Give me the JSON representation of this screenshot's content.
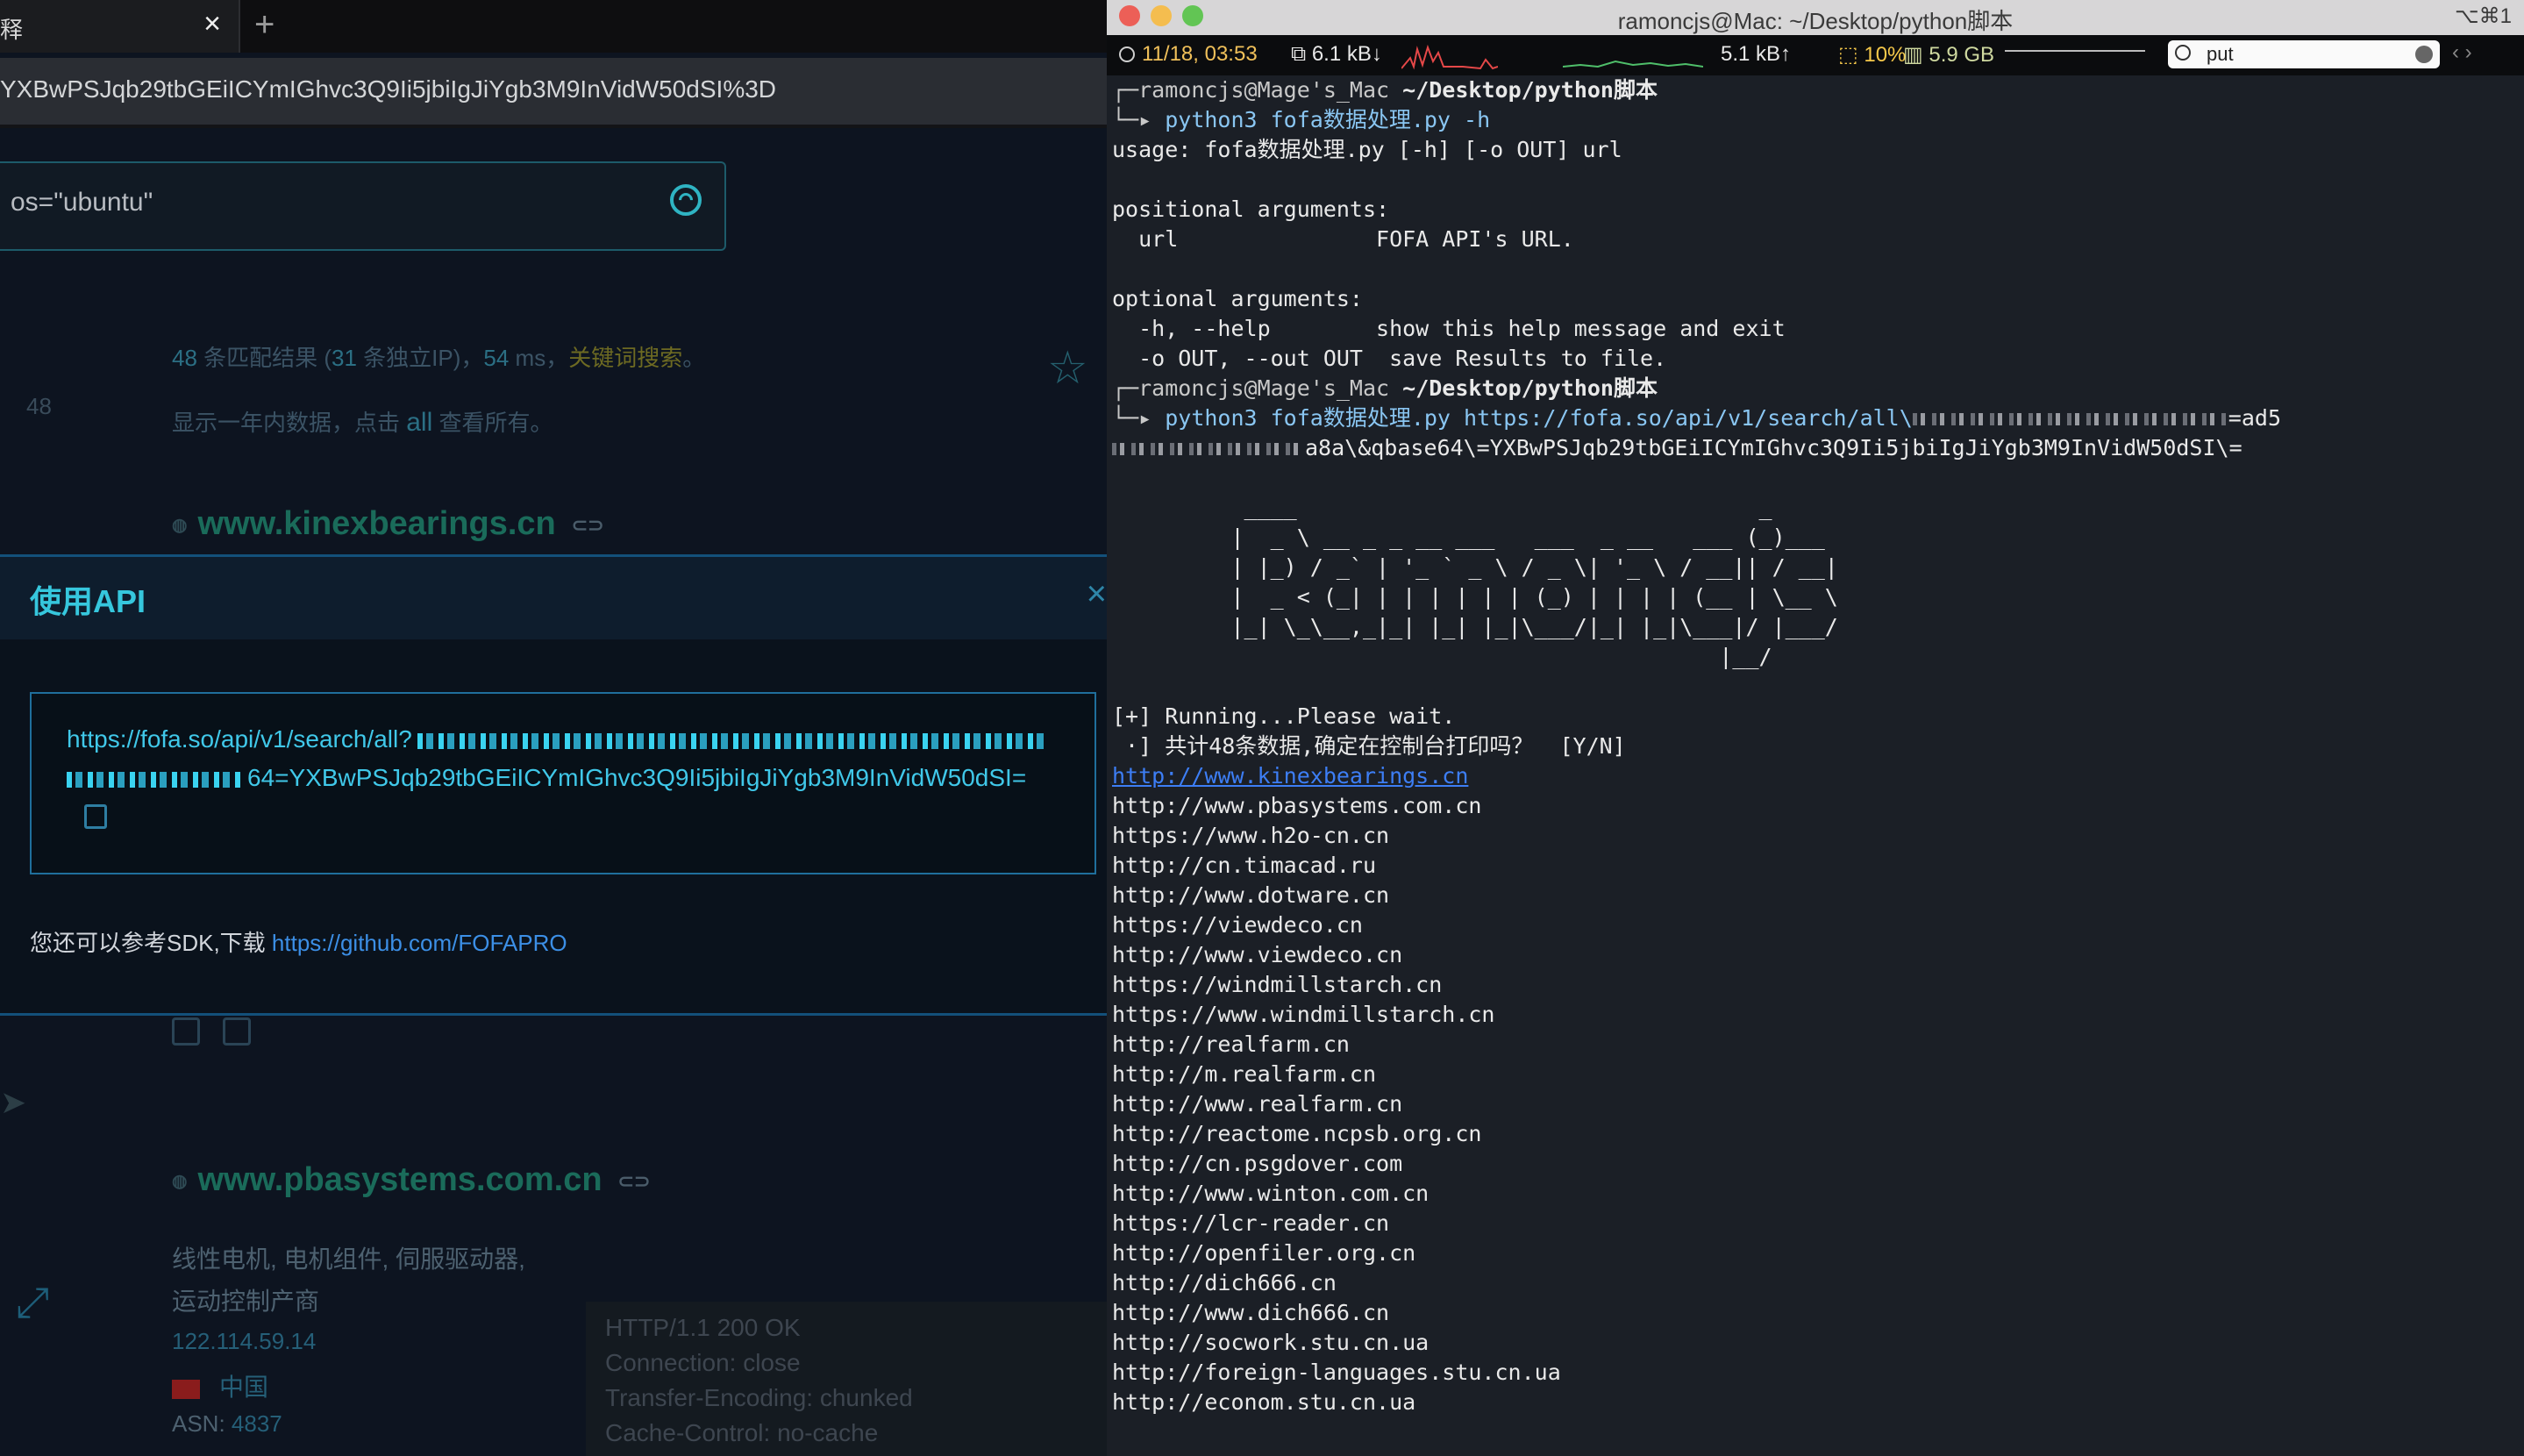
{
  "browser": {
    "tab_title": "释",
    "tab_close": "×",
    "new_tab": "+",
    "address": "YXBwPSJqb29tbGEiICYmIGhvc3Q9Ii5jbiIgJiYgb3M9InVidW50dSI%3D",
    "search_value": "os=\"ubuntu\"",
    "stats": {
      "count": "48",
      "t1": " 条匹配结果 (",
      "unique": "31",
      "t2": " 条独立IP)，",
      "ms": "54",
      "t3": " ms，",
      "keyword": "关键词搜索",
      "t4": "。"
    },
    "count_side": "48",
    "year_text_pre": "显示一年内数据，点击 ",
    "year_all": "all",
    "year_text_post": " 查看所有。",
    "site1": "www.kinexbearings.cn",
    "site2": "www.pbasystems.com.cn",
    "modal": {
      "title": "使用API",
      "close": "×",
      "url_line1": "https://fofa.so/api/v1/search/all?",
      "url_line2": "64=YXBwPSJqb29tbGEiICYmIGhvc3Q9Ii5jbiIgJiYgb3M9InVidW50dSI=",
      "sdk_text": "您还可以参考SDK,下载 ",
      "sdk_link": "https://github.com/FOFAPRO"
    },
    "desc1": "线性电机, 电机组件, 伺服驱动器,",
    "desc2": "运动控制产商",
    "ip": "122.114.59.14",
    "country": "中国",
    "asn_label": "ASN: ",
    "asn": "4837",
    "http": [
      "HTTP/1.1 200 OK",
      "Connection: close",
      "Transfer-Encoding: chunked",
      "Cache-Control: no-cache"
    ]
  },
  "terminal": {
    "title": "ramoncjs@Mac: ~/Desktop/python脚本",
    "shortcut": "⌥⌘1",
    "status": {
      "datetime": "11/18, 03:53",
      "down": "6.1 kB↓",
      "up": "5.1 kB↑",
      "cpu": "10%",
      "mem": "5.9 GB"
    },
    "search": "put",
    "prompt_user": "ramoncjs@Mage's_Mac",
    "prompt_dir": "~/Desktop/python脚本",
    "cmd1": "python3 fofa数据处理.py -h",
    "help_lines": [
      "usage: fofa数据处理.py [-h] [-o OUT] url",
      "",
      "positional arguments:",
      "  url               FOFA API's URL.",
      "",
      "optional arguments:",
      "  -h, --help        show this help message and exit",
      "  -o OUT, --out OUT  save Results to file."
    ],
    "cmd2_pre": "python3 fofa数据处理.py https://fofa.so/api/v1/search/all\\",
    "cmd2_end": "=ad5",
    "cmd2_line2": "a8a\\&qbase64\\=YXBwPSJqb29tbGEiICYmIGhvc3Q9Ii5jbiIgJiYgb3M9InVidW50dSI\\=",
    "ascii": [
      "          ____                                   _",
      "         |  _ \\ __ _ _ __ ___   ___  _ __   ___ (_)___",
      "         | |_) / _` | '_ ` _ \\ / _ \\| '_ \\ / __|| / __|",
      "         |  _ < (_| | | | | | | (_) | | | | (__ | \\__ \\",
      "         |_| \\_\\__,_|_| |_| |_|\\___/|_| |_|\\___|/ |___/",
      "                                              |__/"
    ],
    "running": "[+] Running...Please wait.",
    "prompt_yn": " ·] 共计48条数据,确定在控制台打印吗？  [Y/N]",
    "urls": [
      "http://www.kinexbearings.cn",
      "http://www.pbasystems.com.cn",
      "https://www.h2o-cn.cn",
      "http://cn.timacad.ru",
      "http://www.dotware.cn",
      "https://viewdeco.cn",
      "http://www.viewdeco.cn",
      "https://windmillstarch.cn",
      "https://www.windmillstarch.cn",
      "http://realfarm.cn",
      "http://m.realfarm.cn",
      "http://www.realfarm.cn",
      "http://reactome.ncpsb.org.cn",
      "http://cn.psgdover.com",
      "http://www.winton.com.cn",
      "https://lcr-reader.cn",
      "http://openfiler.org.cn",
      "http://dich666.cn",
      "http://www.dich666.cn",
      "http://socwork.stu.cn.ua",
      "http://foreign-languages.stu.cn.ua",
      "http://econom.stu.cn.ua"
    ]
  }
}
